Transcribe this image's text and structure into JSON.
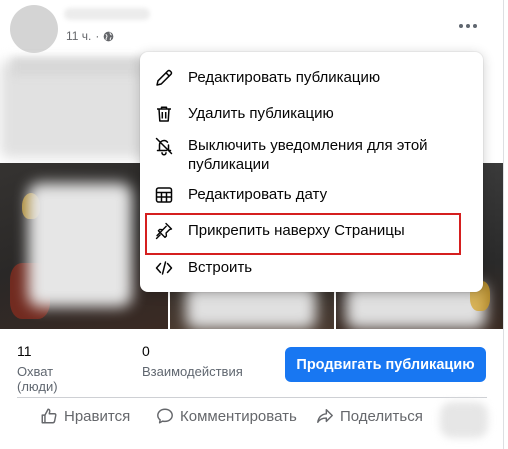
{
  "post": {
    "time": "11 ч.",
    "time_separator": "·"
  },
  "menu": {
    "items": [
      {
        "label": "Редактировать публикацию",
        "icon": "pencil-icon"
      },
      {
        "label": "Удалить публикацию",
        "icon": "trash-icon"
      },
      {
        "label": "Выключить уведомления для этой публикации",
        "label_line1": "Выключить уведомления для этой",
        "label_line2": "публикации",
        "icon": "bell-off-icon"
      },
      {
        "label": "Редактировать дату",
        "icon": "calendar-icon"
      },
      {
        "label": "Прикрепить наверху Страницы",
        "icon": "pin-icon"
      },
      {
        "label": "Встроить",
        "icon": "embed-icon"
      }
    ]
  },
  "stats": {
    "reach_count": "11",
    "reach_label": "Охват (люди)",
    "engagement_count": "0",
    "engagement_label": "Взаимодействия"
  },
  "promote_label": "Продвигать публикацию",
  "actions": {
    "like": "Нравится",
    "comment": "Комментировать",
    "share": "Поделиться"
  },
  "colors": {
    "accent": "#1877f2",
    "highlight_border": "#d51f1f",
    "muted_text": "#65676b"
  }
}
